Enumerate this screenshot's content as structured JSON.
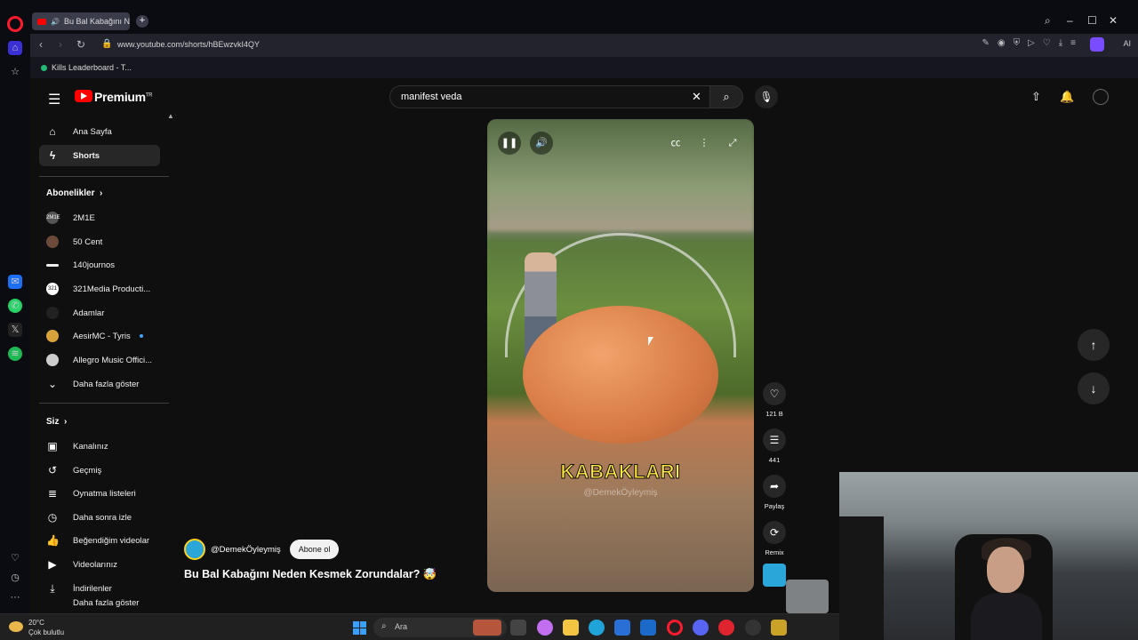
{
  "browser": {
    "tab_title": "Bu Bal Kabağını Nede",
    "url": "www.youtube.com/shorts/hBEwzvkI4QY",
    "bookmark": "Kills Leaderboard - T...",
    "ai_label": "AI"
  },
  "header": {
    "brand": "Premium",
    "brand_sup": "TR",
    "search_value": "manifest veda"
  },
  "sidebar": {
    "main_items": [
      {
        "label": "Ana Sayfa",
        "icon": "home-icon"
      },
      {
        "label": "Shorts",
        "icon": "shorts-icon"
      }
    ],
    "subscriptions_title": "Abonelikler",
    "subscriptions": [
      {
        "label": "2M1E",
        "avatar": "2M1E"
      },
      {
        "label": "50 Cent",
        "avatar": ""
      },
      {
        "label": "140journos",
        "avatar": ""
      },
      {
        "label": "321Media Producti...",
        "avatar": "321"
      },
      {
        "label": "Adamlar",
        "avatar": ""
      },
      {
        "label": "AesirMC - Tyris",
        "avatar": ""
      },
      {
        "label": "Allegro Music Offici...",
        "avatar": ""
      }
    ],
    "show_more": "Daha fazla göster",
    "you_title": "Siz",
    "you_items": [
      {
        "label": "Kanalınız",
        "icon": "channel-icon"
      },
      {
        "label": "Geçmiş",
        "icon": "history-icon"
      },
      {
        "label": "Oynatma listeleri",
        "icon": "playlist-icon"
      },
      {
        "label": "Daha sonra izle",
        "icon": "watch-later-icon"
      },
      {
        "label": "Beğendiğim videolar",
        "icon": "like-icon"
      },
      {
        "label": "Videolarınız",
        "icon": "your-videos-icon"
      },
      {
        "label": "İndirilenler",
        "icon": "download-icon"
      }
    ],
    "more_cut": "Daha fazla göster"
  },
  "video": {
    "caption": "KABAKLARI",
    "watermark": "@DemekÖyleymiş"
  },
  "actions": {
    "likes": "121 B",
    "comments": "441",
    "share": "Paylaş",
    "remix": "Remix"
  },
  "short_info": {
    "channel": "@DemekÖyleymiş",
    "subscribe": "Abone ol",
    "title": "Bu Bal Kabağını Neden Kesmek Zorundalar? 🤯"
  },
  "taskbar": {
    "temp": "20°C",
    "weather": "Çok bulutlu",
    "search": "Ara"
  }
}
